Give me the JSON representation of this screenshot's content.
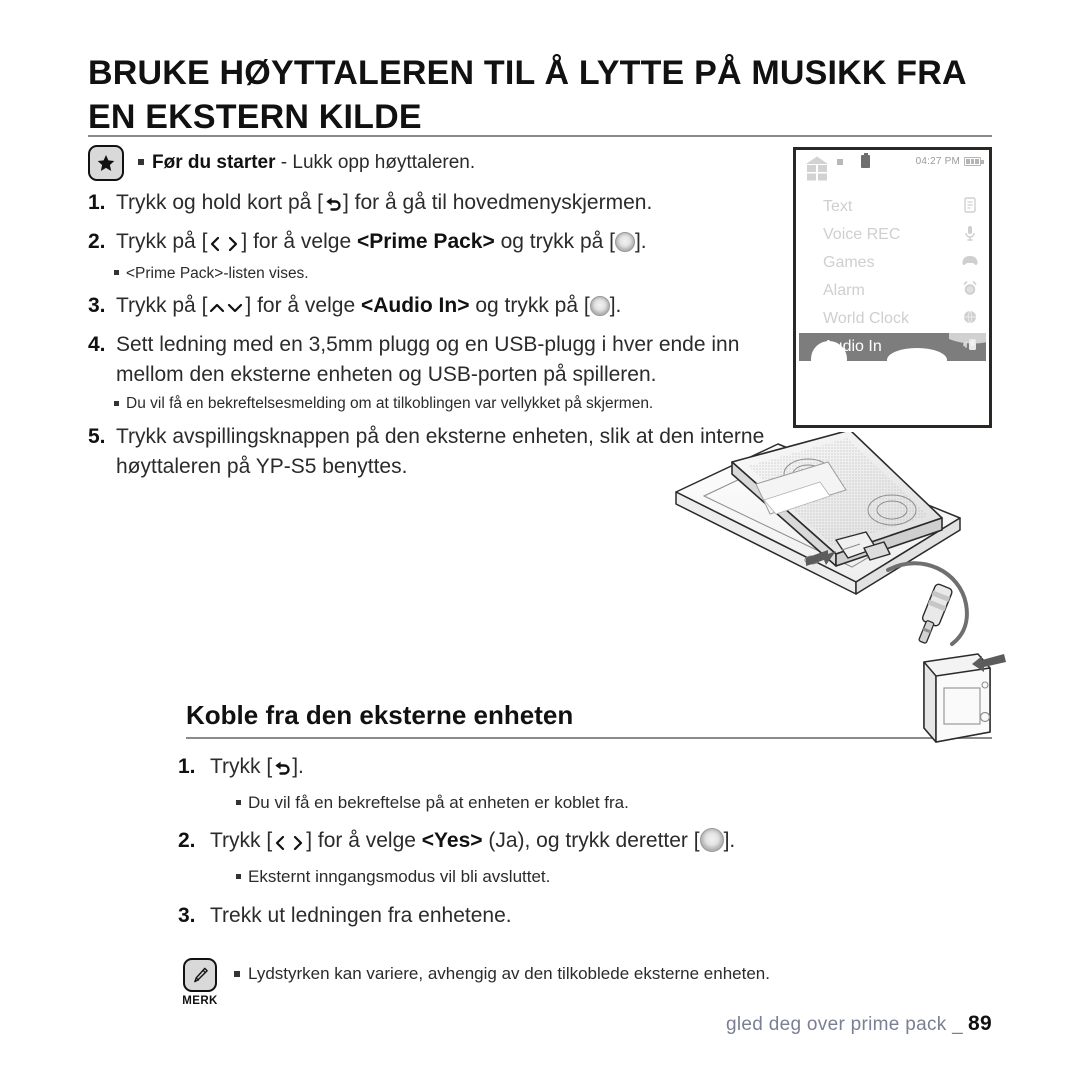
{
  "title": "BRUKE HØYTTALEREN TIL Å LYTTE PÅ MUSIKK FRA EN EKSTERN KILDE",
  "prestart": {
    "icon": "star-badge-icon",
    "bold": "Før du starter",
    "rest": " - Lukk opp høyttaleren."
  },
  "steps": [
    {
      "num": "1.",
      "parts": [
        {
          "t": "text",
          "v": "Trykk og hold kort på ["
        },
        {
          "t": "icon",
          "v": "back-arrow-icon"
        },
        {
          "t": "text",
          "v": "] for å gå til hovedmenyskjermen."
        }
      ]
    },
    {
      "num": "2.",
      "parts": [
        {
          "t": "text",
          "v": "Trykk på ["
        },
        {
          "t": "icon",
          "v": "left-right-chevrons-icon"
        },
        {
          "t": "text",
          "v": "] for å velge "
        },
        {
          "t": "bold",
          "v": "<Prime Pack>"
        },
        {
          "t": "text",
          "v": " og trykk på ["
        },
        {
          "t": "icon",
          "v": "select-button-icon"
        },
        {
          "t": "text",
          "v": "]."
        }
      ],
      "subnote": "<Prime Pack>-listen vises."
    },
    {
      "num": "3.",
      "parts": [
        {
          "t": "text",
          "v": "Trykk på ["
        },
        {
          "t": "icon",
          "v": "up-down-chevrons-icon"
        },
        {
          "t": "text",
          "v": "] for å velge "
        },
        {
          "t": "bold",
          "v": "<Audio In>"
        },
        {
          "t": "text",
          "v": " og trykk på ["
        },
        {
          "t": "icon",
          "v": "select-button-icon"
        },
        {
          "t": "text",
          "v": "]."
        }
      ]
    },
    {
      "num": "4.",
      "parts": [
        {
          "t": "text",
          "v": "Sett ledning med en 3,5mm plugg og en USB-plugg i hver ende inn mellom den eksterne enheten og USB-porten på spilleren."
        }
      ],
      "subnote": "Du vil få en bekreftelsesmelding om at tilkoblingen var vellykket på skjermen."
    },
    {
      "num": "5.",
      "parts": [
        {
          "t": "text",
          "v": "Trykk avspillingsknappen på den eksterne enheten, slik at den interne høyttaleren på YP-S5 benyttes."
        }
      ]
    }
  ],
  "section2": {
    "heading": "Koble fra den eksterne enheten",
    "steps": [
      {
        "num": "1.",
        "parts": [
          {
            "t": "text",
            "v": "Trykk ["
          },
          {
            "t": "icon",
            "v": "back-arrow-icon"
          },
          {
            "t": "text",
            "v": "]."
          }
        ],
        "subnote": "Du vil få en bekreftelse på at enheten er koblet fra."
      },
      {
        "num": "2.",
        "parts": [
          {
            "t": "text",
            "v": "Trykk ["
          },
          {
            "t": "icon",
            "v": "left-right-chevrons-icon"
          },
          {
            "t": "text",
            "v": "] for å velge "
          },
          {
            "t": "bold",
            "v": "<Yes>"
          },
          {
            "t": "text",
            "v": " (Ja), og trykk deretter ["
          },
          {
            "t": "icon",
            "v": "select-button-icon-big"
          },
          {
            "t": "text",
            "v": "]."
          }
        ],
        "subnote": "Eksternt inngangsmodus vil bli avsluttet."
      },
      {
        "num": "3.",
        "parts": [
          {
            "t": "text",
            "v": "Trekk ut ledningen fra enhetene."
          }
        ]
      }
    ]
  },
  "note": {
    "icon": "pen-badge-icon",
    "label": "MERK",
    "text": "Lydstyrken kan variere, avhengig av den tilkoblede eksterne enheten."
  },
  "footer": {
    "text": "gled deg over prime pack _",
    "page": "89"
  },
  "device": {
    "status": {
      "home_icon": "home-icon",
      "time": "04:27 PM",
      "battery_icon": "battery-icon"
    },
    "menu": [
      {
        "label": "Text",
        "icon": "document-icon",
        "selected": false
      },
      {
        "label": "Voice REC",
        "icon": "microphone-icon",
        "selected": false
      },
      {
        "label": "Games",
        "icon": "gamepad-icon",
        "selected": false
      },
      {
        "label": "Alarm",
        "icon": "alarm-clock-icon",
        "selected": false
      },
      {
        "label": "World Clock",
        "icon": "globe-icon",
        "selected": false
      },
      {
        "label": "Audio In",
        "icon": "audio-in-icon",
        "selected": true
      }
    ]
  },
  "colors": {
    "rule": "#8a8a8a",
    "footer_text": "#7b7f93",
    "selected_row": "#7d7d7d",
    "menu_text": "#cfcfcf"
  },
  "illustration": {
    "name": "player-connected-to-external-device-illustration"
  }
}
